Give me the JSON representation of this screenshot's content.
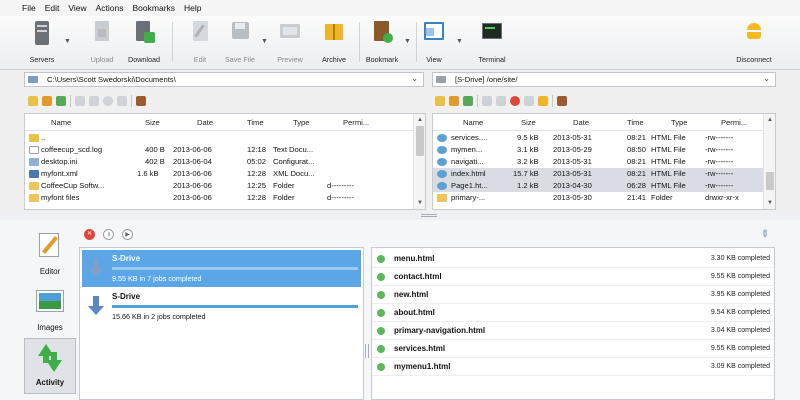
{
  "menu": [
    "File",
    "Edit",
    "View",
    "Actions",
    "Bookmarks",
    "Help"
  ],
  "toolbar": {
    "servers": "Servers",
    "upload": "Upload",
    "download": "Download",
    "edit": "Edit",
    "save_file": "Save File",
    "preview": "Preview",
    "archive": "Archive",
    "bookmark": "Bookmark",
    "view": "View",
    "terminal": "Terminal",
    "disconnect": "Disconnect"
  },
  "local": {
    "path": "C:\\Users\\Scott Swedorski\\Documents\\",
    "columns": [
      "Name",
      "Size",
      "Date",
      "Time",
      "Type",
      "Permi..."
    ],
    "rows": [
      {
        "name": "..",
        "size": "",
        "date": "",
        "time": "",
        "type": "",
        "perm": ""
      },
      {
        "name": "coffeecup_scd.log",
        "size": "400 B",
        "date": "2013-06-06",
        "time": "12:18",
        "type": "Text Docu...",
        "perm": ""
      },
      {
        "name": "desktop.ini",
        "size": "402 B",
        "date": "2013-06-04",
        "time": "05:02",
        "type": "Configurat...",
        "perm": ""
      },
      {
        "name": "myfont.xml",
        "size": "1.6 kB",
        "date": "2013-06-06",
        "time": "12:28",
        "type": "XML Docu...",
        "perm": ""
      },
      {
        "name": "CoffeeCup Softw...",
        "size": "",
        "date": "2013-06-06",
        "time": "12:25",
        "type": "Folder",
        "perm": "d---------"
      },
      {
        "name": "myfont files",
        "size": "",
        "date": "2013-06-06",
        "time": "12:28",
        "type": "Folder",
        "perm": "d---------"
      }
    ]
  },
  "remote": {
    "path": "[S-Drive] /one/site/",
    "columns": [
      "Name",
      "Size",
      "Date",
      "Time",
      "Type",
      "Permi..."
    ],
    "rows": [
      {
        "name": "services....",
        "size": "9.5 kB",
        "date": "2013-05-31",
        "time": "08:21",
        "type": "HTML File",
        "perm": "-rw-------"
      },
      {
        "name": "mymen...",
        "size": "3.1 kB",
        "date": "2013-05-29",
        "time": "08:50",
        "type": "HTML File",
        "perm": "-rw-------"
      },
      {
        "name": "navigati...",
        "size": "3.2 kB",
        "date": "2013-05-31",
        "time": "08:21",
        "type": "HTML File",
        "perm": "-rw-------"
      },
      {
        "name": "index.html",
        "size": "15.7 kB",
        "date": "2013-05-31",
        "time": "08:21",
        "type": "HTML File",
        "perm": "-rw-------"
      },
      {
        "name": "Page1.ht...",
        "size": "1.2 kB",
        "date": "2013-04-30",
        "time": "06:28",
        "type": "HTML File",
        "perm": "-rw-------"
      },
      {
        "name": "primary-...",
        "size": "",
        "date": "2013-05-30",
        "time": "21:41",
        "type": "Folder",
        "perm": "drwxr-xr-x"
      }
    ]
  },
  "sidebar": {
    "editor": "Editor",
    "images": "Images",
    "activity": "Activity"
  },
  "jobs": [
    {
      "title": "S-Drive",
      "status": "9.55 KB in 7 jobs completed"
    },
    {
      "title": "S-Drive",
      "status": "15.66 KB in 2 jobs completed"
    }
  ],
  "files": [
    {
      "name": "menu.html",
      "status": "3.30 KB completed"
    },
    {
      "name": "contact.html",
      "status": "9.55 KB completed"
    },
    {
      "name": "new.html",
      "status": "3.95 KB completed"
    },
    {
      "name": "about.html",
      "status": "9.54 KB completed"
    },
    {
      "name": "primary-navigation.html",
      "status": "3.04 KB completed"
    },
    {
      "name": "services.html",
      "status": "9.55 KB completed"
    },
    {
      "name": "mymenu1.html",
      "status": "3.09 KB completed"
    }
  ],
  "colors": {
    "accent": "#5aa6e6",
    "status_dot": "#5cb85c",
    "progress": "#4fa0d8"
  }
}
